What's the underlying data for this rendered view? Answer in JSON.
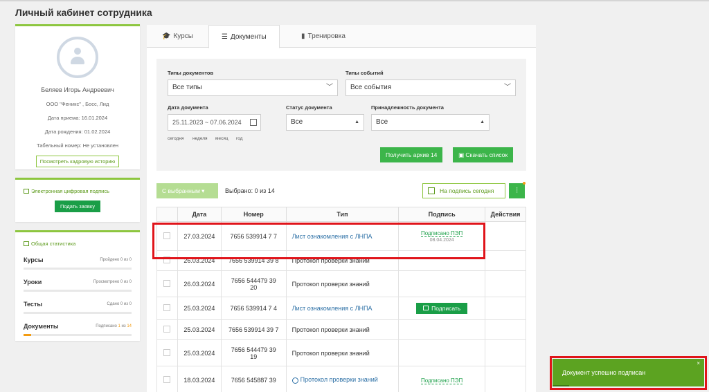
{
  "page_title": "Личный кабинет сотрудника",
  "profile": {
    "name": "Беляев Игорь Андреевич",
    "company": "ООО \"Феникс\" , Босс, Лид",
    "hire_date": "Дата приема: 16.01.2024",
    "birth_date": "Дата рождения: 01.02.2024",
    "tab_number": "Табельный номер: Не установлен",
    "history_button": "Посмотреть кадровую историю"
  },
  "signature": {
    "title": "Электронная цифровая подпись",
    "request_button": "Подать заявку"
  },
  "stats": {
    "title": "Общая статистика",
    "rows": [
      {
        "label": "Курсы",
        "prefix": "Пройдено",
        "done": "0",
        "total": "0",
        "progress": 0
      },
      {
        "label": "Уроки",
        "prefix": "Просмотрено",
        "done": "0",
        "total": "0",
        "progress": 0
      },
      {
        "label": "Тесты",
        "prefix": "Сдано",
        "done": "0",
        "total": "0",
        "progress": 0
      },
      {
        "label": "Документы",
        "prefix": "Подписано",
        "done": "1",
        "total": "14",
        "progress": 0.07
      }
    ],
    "of_word": "из"
  },
  "tabs": [
    {
      "label": "Курсы",
      "icon": "graduation-cap-icon"
    },
    {
      "label": "Документы",
      "icon": "list-icon"
    },
    {
      "label": "Тренировка",
      "icon": "book-icon"
    }
  ],
  "filters": {
    "doc_types_label": "Типы документов",
    "doc_types_value": "Все типы",
    "event_types_label": "Типы событий",
    "event_types_value": "Все события",
    "doc_date_label": "Дата документа",
    "doc_date_value": "25.11.2023 ~ 07.06.2024",
    "quick_ranges": [
      "сегодня",
      "неделя",
      "месяц",
      "год"
    ],
    "status_label": "Статус документа",
    "status_value": "Все",
    "ownership_label": "Принадлежность документа",
    "ownership_value": "Все",
    "archive_button": "Получить архив 14",
    "download_button": "Скачать список"
  },
  "toolbar": {
    "bulk_button": "С выбранным",
    "selected_text": "Выбрано: 0 из 14",
    "today_button": "На подпись сегодня"
  },
  "table": {
    "headers": [
      "",
      "Дата",
      "Номер",
      "Тип",
      "Подпись",
      "Действия"
    ],
    "rows": [
      {
        "date": "27.03.2024",
        "number": "7656 539914 7 7",
        "type": "Лист ознакомления с ЛНПА",
        "link": true,
        "sign": "Подписано ПЭП",
        "sign_date": "08.04.2024"
      },
      {
        "date": "26.03.2024",
        "number": "7656 539914 39 8",
        "type": "Протокол проверки знаний",
        "link": false,
        "sign": "",
        "sign_date": ""
      },
      {
        "date": "26.03.2024",
        "number": "7656 544479 39 20",
        "type": "Протокол проверки знаний",
        "link": false,
        "sign": "",
        "sign_date": ""
      },
      {
        "date": "25.03.2024",
        "number": "7656 539914 7 4",
        "type": "Лист ознакомления с ЛНПА",
        "link": true,
        "sign_button": "Подписать"
      },
      {
        "date": "25.03.2024",
        "number": "7656 539914 39 7",
        "type": "Протокол проверки знаний",
        "link": false,
        "sign": "",
        "sign_date": ""
      },
      {
        "date": "25.03.2024",
        "number": "7656 544479 39 19",
        "type": "Протокол проверки знаний",
        "link": false,
        "sign": "",
        "sign_date": ""
      },
      {
        "date": "18.03.2024",
        "number": "7656 545887 39",
        "type": "Протокол проверки знаний",
        "link": true,
        "person_icon": true,
        "sign": "Подписано ПЭП",
        "sign_date": ""
      }
    ]
  },
  "toast": {
    "message": "Документ успешно подписан",
    "close": "×"
  },
  "colors": {
    "accent_green": "#3cb54a",
    "dark_green": "#1a9e47",
    "border_green": "#8dc63f",
    "highlight_red": "#e0141a",
    "progress_orange": "#f39c12",
    "toast_green": "#5ca321"
  }
}
